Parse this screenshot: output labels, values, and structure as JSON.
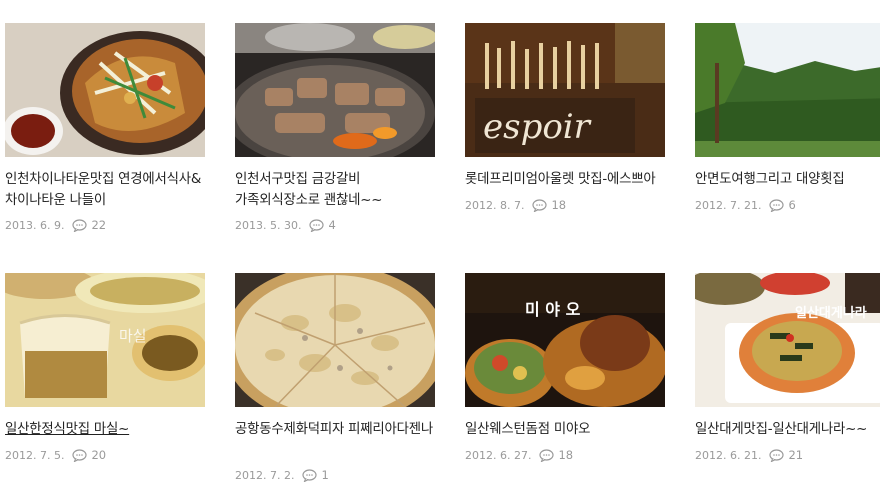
{
  "posts": [
    {
      "title": "인천차이나타운맛집 연경에서식사&차이나타운 나들이",
      "date": "2013. 6. 9.",
      "comments": "22",
      "thumb_icon": "food-photo"
    },
    {
      "title": "인천서구맛집 금강갈비 가족외식장소로 괜찮네~~",
      "date": "2013. 5. 30.",
      "comments": "4",
      "thumb_icon": "grill-photo"
    },
    {
      "title": "롯데프리미엄아울렛 맛집-에스쁘아",
      "date": "2012. 8. 7.",
      "comments": "18",
      "thumb_icon": "restaurant-photo"
    },
    {
      "title": "안면도여행그리고 대양횟집",
      "date": "2012. 7. 21.",
      "comments": "6",
      "thumb_icon": "forest-photo"
    },
    {
      "title": "일산한정식맛집 마실~",
      "date": "2012. 7. 5.",
      "comments": "20",
      "thumb_icon": "korean-meal-photo"
    },
    {
      "title": "공항동수제화덕피자 피쩨리아다젠나",
      "date": "2012. 7. 2.",
      "comments": "1",
      "thumb_icon": "pizza-photo"
    },
    {
      "title": "일산웨스턴돔점 미야오",
      "date": "2012. 6. 27.",
      "comments": "18",
      "thumb_icon": "bento-photo"
    },
    {
      "title": "일산대게맛집-일산대게나라~~",
      "date": "2012. 6. 21.",
      "comments": "21",
      "thumb_icon": "crab-photo"
    }
  ],
  "thumb_overlays": {
    "espoir": "espoir",
    "masil": "마실",
    "miyao": "미 야 오",
    "daege": "일산대게나라"
  },
  "colors": {
    "title": "#222222",
    "meta": "#9a9a9a",
    "background": "#ffffff"
  }
}
